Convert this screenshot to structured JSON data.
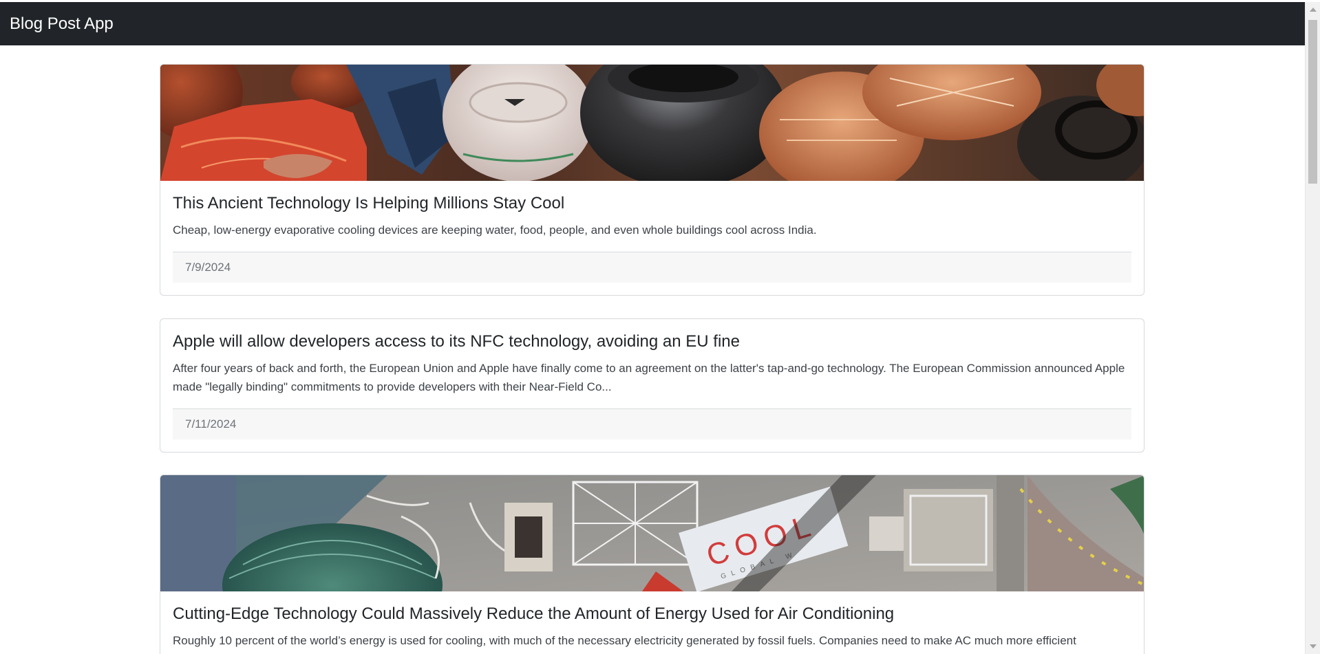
{
  "app": {
    "brand": "Blog Post App"
  },
  "posts": [
    {
      "title": "This Ancient Technology Is Helping Millions Stay Cool",
      "description": "Cheap, low-energy evaporative cooling devices are keeping water, food, people, and even whole buildings cool across India.",
      "date": "7/9/2024",
      "has_image": true,
      "image_theme": "clay-pots"
    },
    {
      "title": "Apple will allow developers access to its NFC technology, avoiding an EU fine",
      "description": "After four years of back and forth, the European Union and Apple have finally come to an agreement on the latter's tap-and-go technology. The European Commission announced Apple made \"legally binding\" commitments to provide developers with their Near-Field Co...",
      "date": "7/11/2024",
      "has_image": false
    },
    {
      "title": "Cutting-Edge Technology Could Massively Reduce the Amount of Energy Used for Air Conditioning",
      "description": "Roughly 10 percent of the world’s energy is used for cooling, with much of the necessary electricity generated by fossil fuels. Companies need to make AC much more efficient",
      "has_image": true,
      "image_theme": "rooftop-aerial",
      "image_text": {
        "sign_word": "COOL",
        "sign_subtext": "GLOBAL W"
      }
    }
  ],
  "colors": {
    "navbar_bg": "#212529",
    "navbar_text": "#ffffff",
    "card_border": "#d6d9dc",
    "footer_bg": "#f7f7f7",
    "date_text": "#6c737a"
  }
}
